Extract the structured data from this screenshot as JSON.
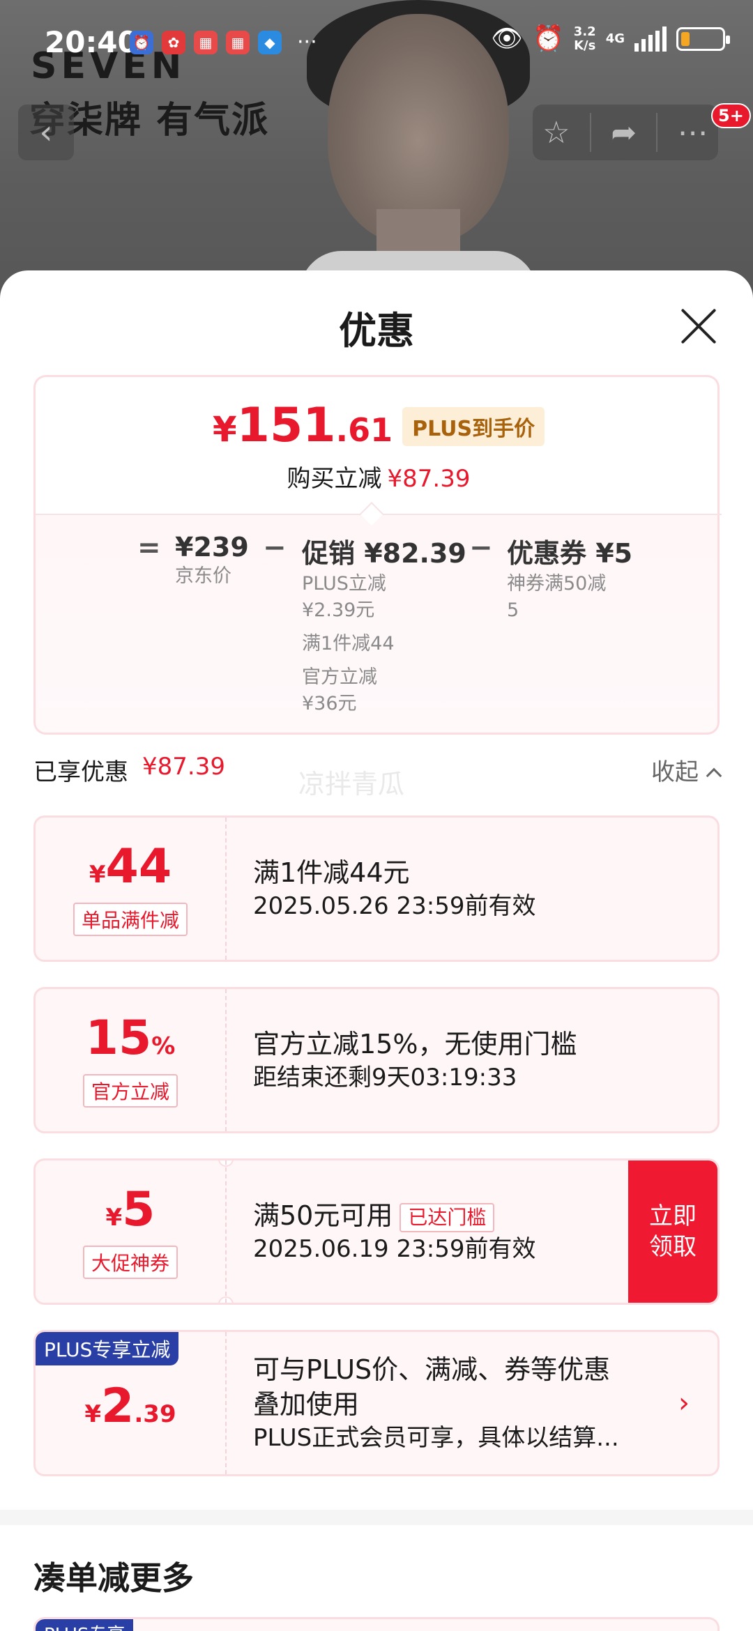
{
  "status_bar": {
    "time": "20:40",
    "net_speed_top": "3.2",
    "net_speed_bottom": "K/s",
    "network": "4G",
    "more": "···",
    "notif_icons": [
      "alarm-icon",
      "huawei-icon",
      "notes-icon",
      "notes-icon",
      "shield-icon"
    ]
  },
  "hero": {
    "brand_logo": "SEVEN",
    "brand_slogan": "穿柒牌 有气派",
    "badge_count": "5+"
  },
  "sheet": {
    "title": "优惠"
  },
  "summary": {
    "currency": "¥",
    "price_int": "151",
    "price_dec": ".61",
    "plus_label": "PLUS到手价",
    "reduce_label": "购买立减",
    "reduce_amount": "¥87.39",
    "equals": "=",
    "minus": "−",
    "jd_price": "¥239",
    "jd_label": "京东价",
    "promo_head": "促销 ¥82.39",
    "promo_lines": [
      "PLUS立减",
      "¥2.39元",
      "满1件减44",
      "官方立减",
      "¥36元"
    ],
    "coupon_head": "优惠券 ¥5",
    "coupon_lines": [
      "神券满50减",
      "5"
    ]
  },
  "enjoyed": {
    "label": "已享优惠",
    "amount": "¥87.39",
    "watermark": "凉拌青瓜",
    "collapse_label": "收起"
  },
  "coupons": [
    {
      "cur": "¥",
      "value": "44",
      "suffix": "",
      "tag": "单品满件减",
      "title": "满1件减44元",
      "desc": "2025.05.26 23:59前有效"
    },
    {
      "cur": "",
      "value": "15",
      "suffix": "%",
      "tag": "官方立减",
      "title": "官方立减15%，无使用门槛",
      "desc": "距结束还剩9天03:19:33"
    },
    {
      "cur": "¥",
      "value": "5",
      "suffix": "",
      "tag": "大促神券",
      "title": "满50元可用",
      "met_tag": "已达门槛",
      "desc": "2025.06.19 23:59前有效",
      "button": "立即领取"
    },
    {
      "ribbon": "PLUS专享立减",
      "cur": "¥",
      "value": "2",
      "suffix": ".39",
      "title_line1": "可与PLUS价、满减、券等优惠",
      "title_line2": "叠加使用",
      "desc": "PLUS正式会员可享，具体以结算..."
    }
  ],
  "more_section": {
    "title": "凑单减更多",
    "peek_ribbon": "PLUS专享"
  },
  "colors": {
    "accent_red": "#e8192c",
    "plus_blue": "#2a3fa6",
    "plus_gold_bg": "#fdeed8"
  }
}
